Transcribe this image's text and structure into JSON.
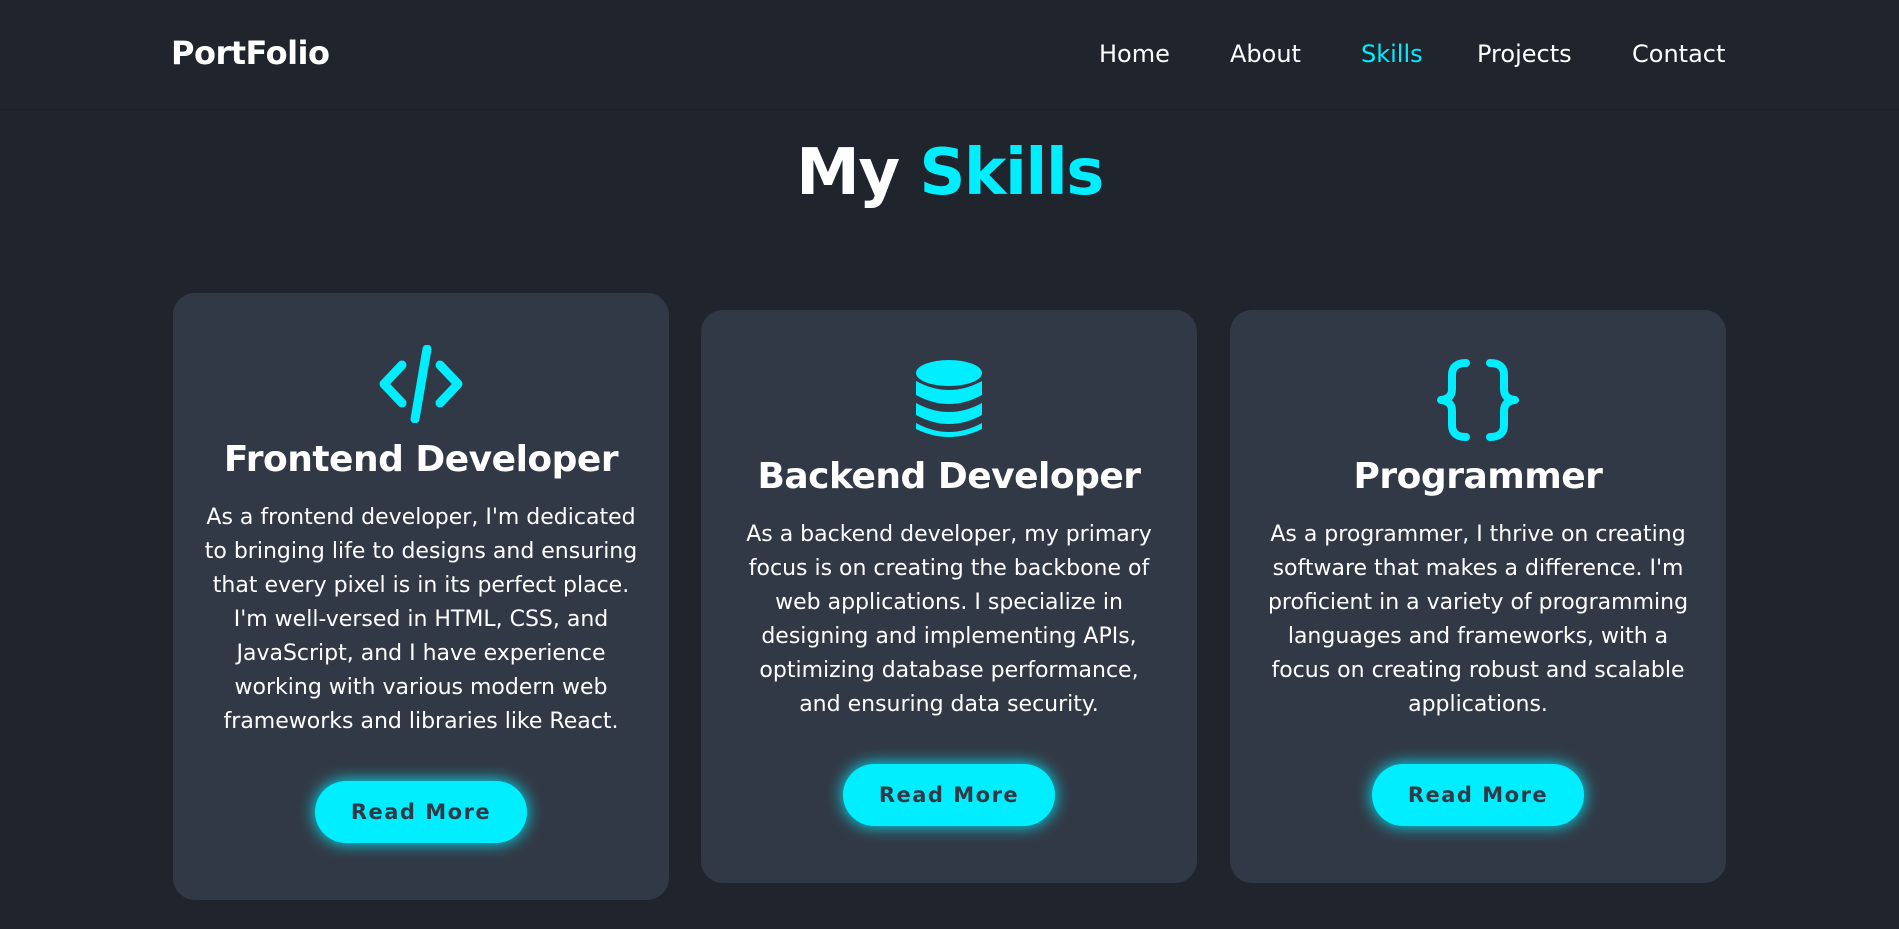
{
  "header": {
    "logo": "PortFolio",
    "nav": [
      {
        "label": "Home"
      },
      {
        "label": "About"
      },
      {
        "label": "Skills"
      },
      {
        "label": "Projects"
      },
      {
        "label": "Contact"
      }
    ],
    "active_nav": "Skills"
  },
  "section": {
    "title_plain": "My",
    "title_accent": "Skills"
  },
  "cards": [
    {
      "icon": "code-icon",
      "title": "Frontend Developer",
      "lines": [
        "As a frontend developer, I'm dedicated",
        "to bringing life to designs and ensuring",
        "that every pixel is in its perfect place.",
        "I'm well-versed in HTML, CSS, and",
        "JavaScript, and I have experience",
        "working with various modern web",
        "frameworks and libraries like React."
      ],
      "button": "Read More"
    },
    {
      "icon": "database-icon",
      "title": "Backend Developer",
      "lines": [
        "As a backend developer, my primary",
        "focus is on creating the backbone of",
        "web applications. I specialize in",
        "designing and implementing APIs,",
        "optimizing database performance,",
        "and ensuring data security."
      ],
      "button": "Read More"
    },
    {
      "icon": "curly-braces-icon",
      "title": "Programmer",
      "lines": [
        "As a programmer, I thrive on creating",
        "software that makes a difference. I'm",
        "proficient in a variety of programming",
        "languages and frameworks, with a",
        "focus on creating robust and scalable",
        "applications."
      ],
      "button": "Read More"
    }
  ],
  "colors": {
    "accent": "#00eeff",
    "background": "#1f242d",
    "card": "#323946"
  }
}
